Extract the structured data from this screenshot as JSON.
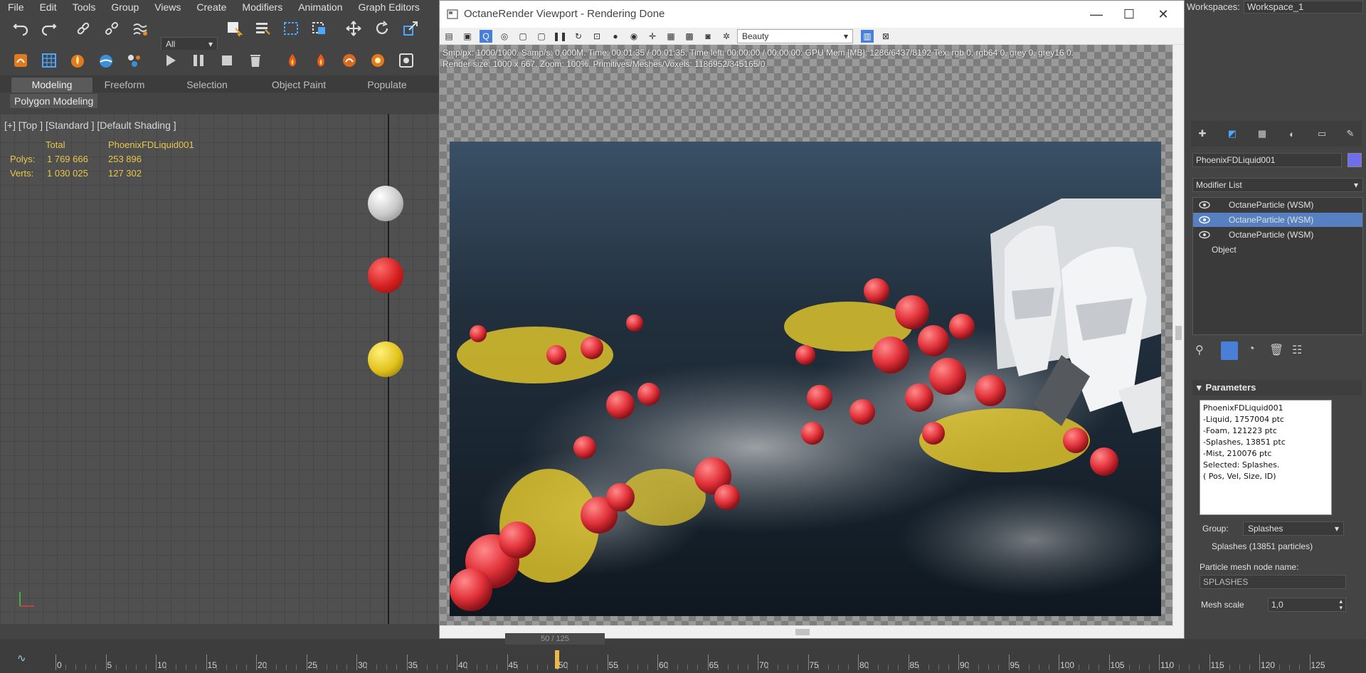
{
  "menu": [
    "File",
    "Edit",
    "Tools",
    "Group",
    "Views",
    "Create",
    "Modifiers",
    "Animation",
    "Graph Editors"
  ],
  "workspace": {
    "label": "Workspaces:",
    "value": "Workspace_1"
  },
  "toolbar": {
    "selection_filter": "All"
  },
  "ribbon": {
    "tabs": [
      "Modeling",
      "Freeform",
      "Selection",
      "Object Paint",
      "Populate"
    ],
    "sub_label": "Polygon Modeling"
  },
  "viewport": {
    "label": "[+] [Top ] [Standard ] [Default Shading ]",
    "stats": {
      "col_total": "Total",
      "col_object": "PhoenixFDLiquid001",
      "polys_label": "Polys:",
      "polys_total": "1 769 666",
      "polys_object": "253 896",
      "verts_label": "Verts:",
      "verts_total": "1 030 025",
      "verts_object": "127 302"
    }
  },
  "octane": {
    "title": "OctaneRender Viewport - Rendering Done",
    "render_pass": "Beauty",
    "info_line1": "Smp/px: 1000/1000.   Samp/s: 0,000M.   Time: 00:01:35 / 00:01:35.   Time left: 00:00:00 / 00:00:00.   GPU Mem [MB]: 1286/6437/8192   Tex: rgb 0, rgb64 0, grey 0, grey16 0.",
    "info_line2": "Render size: 1000 x 667.  Zoom: 100%.  Primitives/Meshes/Voxels: 1186952/345165/0"
  },
  "command_panel": {
    "object_name": "PhoenixFDLiquid001",
    "object_color": "#6f6fee",
    "modifier_list": "Modifier List",
    "stack": [
      {
        "label": "OctaneParticle (WSM)",
        "selected": false
      },
      {
        "label": "OctaneParticle (WSM)",
        "selected": true
      },
      {
        "label": "OctaneParticle (WSM)",
        "selected": false
      },
      {
        "label": "Object",
        "selected": false
      }
    ],
    "parameters": {
      "header": "Parameters",
      "info_lines": [
        "PhoenixFDLiquid001",
        "-Liquid, 1757004 ptc",
        "-Foam, 121223 ptc",
        "-Splashes, 13851 ptc",
        "-Mist, 210076 ptc",
        "Selected: Splashes.",
        "( Pos, Vel, Size, ID)"
      ],
      "group_label": "Group:",
      "group_value": "Splashes",
      "group_count": "Splashes (13851 particles)",
      "mesh_name_label": "Particle mesh node name:",
      "mesh_name_value": "SPLASHES",
      "mesh_scale_label": "Mesh scale",
      "mesh_scale_value": "1,0"
    }
  },
  "timeline": {
    "ticks": [
      "0",
      "5",
      "10",
      "15",
      "20",
      "25",
      "30",
      "35",
      "40",
      "45",
      "50",
      "55",
      "60",
      "65",
      "70",
      "75",
      "80",
      "85",
      "90",
      "95",
      "100",
      "105",
      "110",
      "115",
      "120",
      "125"
    ],
    "current_frame": 50,
    "frame_counter": "50 / 125"
  }
}
